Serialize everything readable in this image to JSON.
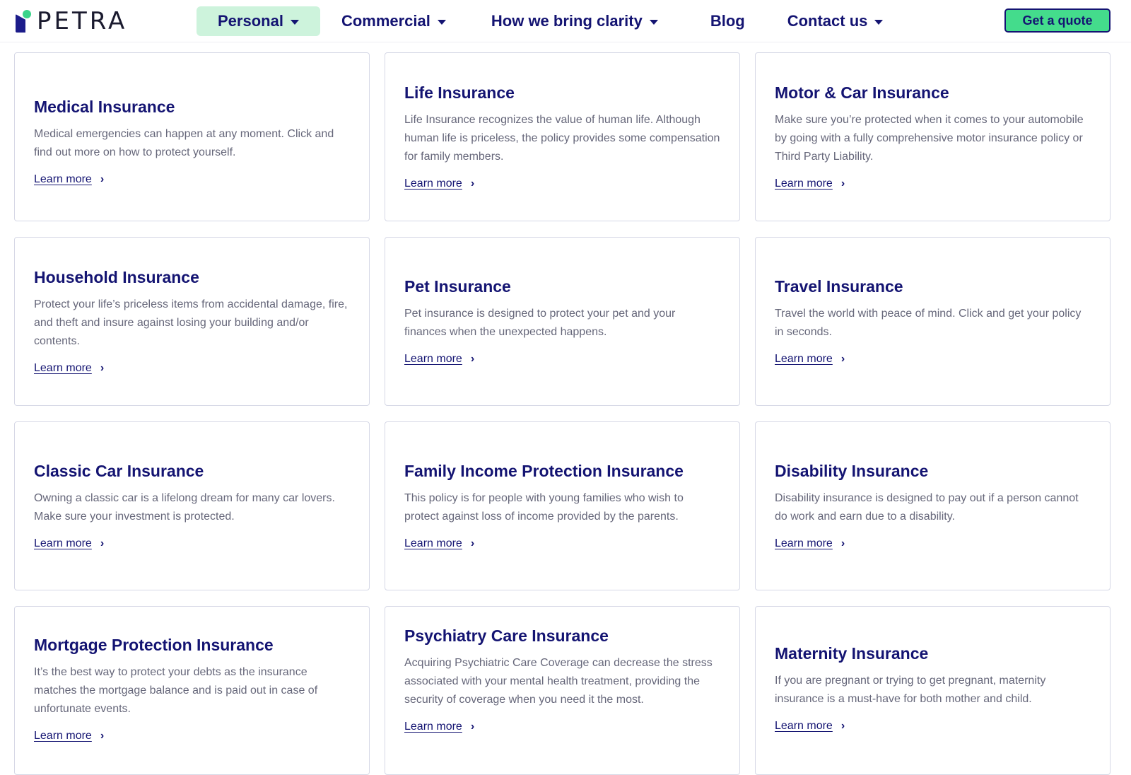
{
  "brand": {
    "name": "PETRA",
    "colors": {
      "navy": "#141472",
      "green": "#44dc8c",
      "light_green": "#cdf3dc"
    }
  },
  "nav": {
    "items": [
      {
        "label": "Personal",
        "dropdown": true,
        "active": true
      },
      {
        "label": "Commercial",
        "dropdown": true,
        "active": false
      },
      {
        "label": "How we bring clarity",
        "dropdown": true,
        "active": false
      },
      {
        "label": "Blog",
        "dropdown": false,
        "active": false
      },
      {
        "label": "Contact us",
        "dropdown": true,
        "active": false
      }
    ],
    "cta_label": "Get a quote"
  },
  "cards": [
    {
      "title": "Medical Insurance",
      "description": "Medical emergencies can happen at any moment. Click and find out more on how to protect yourself.",
      "link": "Learn more"
    },
    {
      "title": "Life Insurance",
      "description": "Life Insurance recognizes the value of human life. Although human life is priceless, the policy provides some compensation for family members.",
      "link": "Learn more"
    },
    {
      "title": "Motor & Car Insurance",
      "description": "Make sure you’re protected when it comes to your automobile by going with a fully comprehensive motor insurance policy or Third Party Liability.",
      "link": "Learn more"
    },
    {
      "title": "Household Insurance",
      "description": "Protect your life’s priceless items from accidental damage, fire, and theft and insure against losing your building and/or contents.",
      "link": "Learn more"
    },
    {
      "title": "Pet Insurance",
      "description": "Pet insurance is designed to protect your pet and your finances when the unexpected happens.",
      "link": "Learn more"
    },
    {
      "title": "Travel Insurance",
      "description": "Travel the world with peace of mind. Click and get your policy in seconds.",
      "link": "Learn more"
    },
    {
      "title": "Classic Car Insurance",
      "description": "Owning a classic car is a lifelong dream for many car lovers. Make sure your investment is protected.",
      "link": "Learn more"
    },
    {
      "title": "Family Income Protection Insurance",
      "description": "This policy is for people with young families who wish to protect against loss of income provided by the parents.",
      "link": "Learn more"
    },
    {
      "title": "Disability Insurance",
      "description": "Disability insurance is designed to pay out if a person cannot do work and earn due to a disability.",
      "link": "Learn more"
    },
    {
      "title": "Mortgage Protection Insurance",
      "description": "It’s the best way to protect your debts as the insurance matches the mortgage balance and is paid out in case of unfortunate events.",
      "link": "Learn more"
    },
    {
      "title": "Psychiatry Care Insurance",
      "description": "Acquiring Psychiatric Care Coverage can decrease the stress associated with your mental health treatment, providing the security of coverage when you need it the most.",
      "link": "Learn more"
    },
    {
      "title": "Maternity Insurance",
      "description": "If you are pregnant or trying to get pregnant, maternity insurance is a must-have for both mother and child.",
      "link": "Learn more"
    }
  ]
}
